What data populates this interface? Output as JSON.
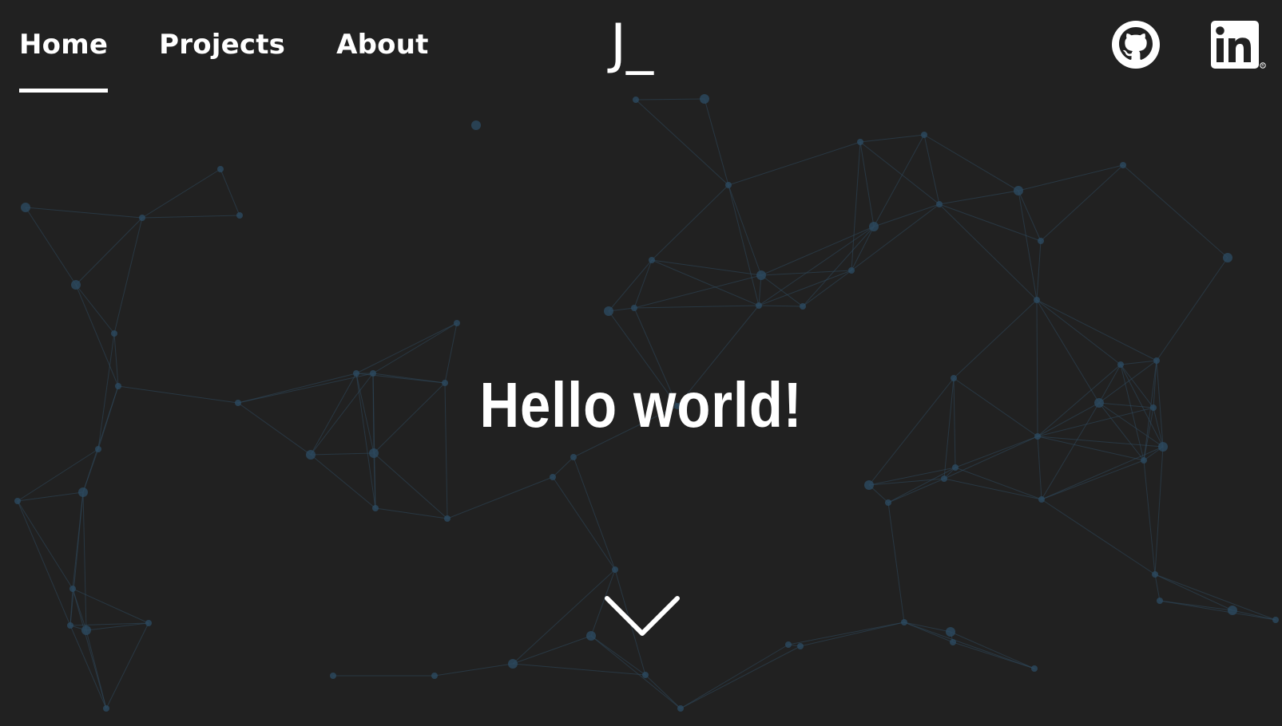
{
  "nav": {
    "items": [
      {
        "label": "Home",
        "active": true
      },
      {
        "label": "Projects",
        "active": false
      },
      {
        "label": "About",
        "active": false
      }
    ]
  },
  "logo": {
    "text": "J_"
  },
  "social": {
    "icons": [
      "github-icon",
      "linkedin-icon"
    ]
  },
  "hero": {
    "title": "Hello world!"
  },
  "colors": {
    "background": "#212121",
    "text": "#ffffff",
    "network": "#2f4a5e"
  }
}
